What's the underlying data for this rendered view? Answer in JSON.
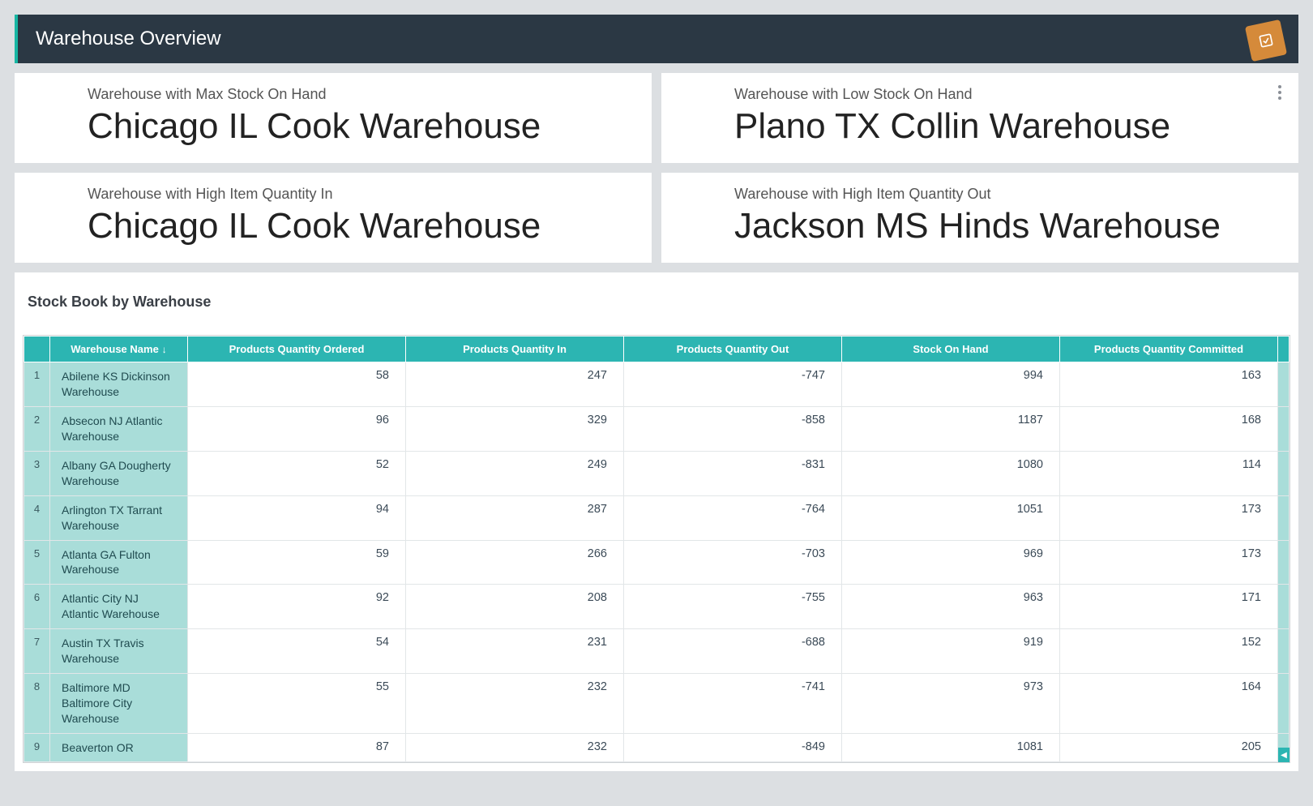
{
  "header": {
    "title": "Warehouse Overview"
  },
  "kpis": [
    {
      "label": "Warehouse with Max Stock On Hand",
      "value": "Chicago IL Cook Warehouse"
    },
    {
      "label": "Warehouse with Low Stock On Hand",
      "value": "Plano TX Collin Warehouse"
    },
    {
      "label": "Warehouse with High Item Quantity In",
      "value": "Chicago IL Cook Warehouse"
    },
    {
      "label": "Warehouse with High Item Quantity Out",
      "value": "Jackson MS Hinds Warehouse"
    }
  ],
  "table": {
    "title": "Stock Book by Warehouse",
    "columns": {
      "name": "Warehouse Name",
      "ordered": "Products Quantity Ordered",
      "in": "Products Quantity In",
      "out": "Products Quantity Out",
      "stock": "Stock On Hand",
      "committed": "Products Quantity Committed"
    },
    "rows": [
      {
        "n": "1",
        "name": "Abilene KS  Dickinson Warehouse",
        "ordered": "58",
        "in": "247",
        "out": "-747",
        "stock": "994",
        "committed": "163"
      },
      {
        "n": "2",
        "name": "Absecon NJ  Atlantic Warehouse",
        "ordered": "96",
        "in": "329",
        "out": "-858",
        "stock": "1187",
        "committed": "168"
      },
      {
        "n": "3",
        "name": "Albany GA  Dougherty Warehouse",
        "ordered": "52",
        "in": "249",
        "out": "-831",
        "stock": "1080",
        "committed": "114"
      },
      {
        "n": "4",
        "name": "Arlington TX  Tarrant Warehouse",
        "ordered": "94",
        "in": "287",
        "out": "-764",
        "stock": "1051",
        "committed": "173"
      },
      {
        "n": "5",
        "name": "Atlanta GA  Fulton Warehouse",
        "ordered": "59",
        "in": "266",
        "out": "-703",
        "stock": "969",
        "committed": "173"
      },
      {
        "n": "6",
        "name": "Atlantic City NJ  Atlantic  Warehouse",
        "ordered": "92",
        "in": "208",
        "out": "-755",
        "stock": "963",
        "committed": "171"
      },
      {
        "n": "7",
        "name": "Austin TX  Travis Warehouse",
        "ordered": "54",
        "in": "231",
        "out": "-688",
        "stock": "919",
        "committed": "152"
      },
      {
        "n": "8",
        "name": "Baltimore MD  Baltimore City Warehouse",
        "ordered": "55",
        "in": "232",
        "out": "-741",
        "stock": "973",
        "committed": "164"
      },
      {
        "n": "9",
        "name": "Beaverton OR",
        "ordered": "87",
        "in": "232",
        "out": "-849",
        "stock": "1081",
        "committed": "205"
      }
    ]
  },
  "colors": {
    "headerBg": "#2b3844",
    "accent": "#2cb5b2",
    "nameCellBg": "#a9ddd9",
    "pageBg": "#dcdfe2",
    "stamp": "#d58a3a"
  }
}
